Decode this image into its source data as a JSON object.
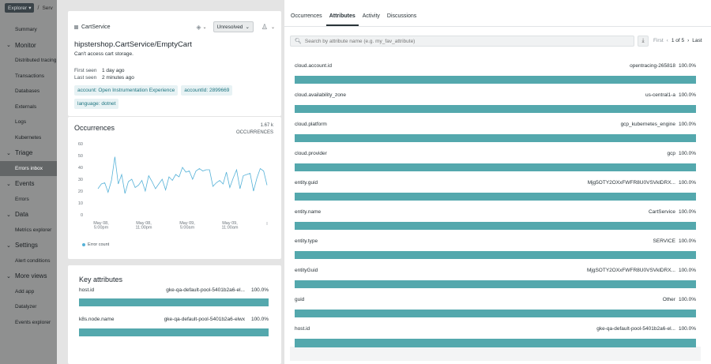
{
  "nav": {
    "explorer_label": "Explorer",
    "crumb_sep": "/",
    "crumb_text": "Serv",
    "summary": "Summary",
    "monitor": "Monitor",
    "monitor_items": [
      "Distributed tracing",
      "Transactions",
      "Databases",
      "Externals",
      "Logs",
      "Kubernetes"
    ],
    "triage": "Triage",
    "triage_items": [
      "Errors inbox"
    ],
    "events": "Events",
    "events_items": [
      "Errors"
    ],
    "data": "Data",
    "data_items": [
      "Metrics explorer"
    ],
    "settings": "Settings",
    "settings_items": [
      "Alert conditions"
    ],
    "more_views": "More views",
    "more_items": [
      "Add app",
      "Datalyzer",
      "Events explorer"
    ]
  },
  "error": {
    "service": "CartService",
    "status": "Unresolved",
    "title": "hipstershop.CartService/EmptyCart",
    "message": "Can't access cart storage.",
    "first_seen_label": "First seen",
    "first_seen": "1 day ago",
    "last_seen_label": "Last seen",
    "last_seen": "2 minutes ago",
    "tags": [
      "account: Open Instrumentation Experience",
      "accountId: 2899669",
      "language: dotnet"
    ]
  },
  "occurrences": {
    "title": "Occurrences",
    "count": "1.67 k",
    "count_label": "OCCURRENCES",
    "legend": "Error count"
  },
  "chart_data": {
    "type": "line",
    "x_ticks": [
      "May 08,\n5:00pm",
      "May 08,\n11:00pm",
      "May 09,\n5:00am",
      "May 09,\n11:00am"
    ],
    "ylim": [
      0,
      60
    ],
    "y_ticks": [
      0,
      10,
      20,
      30,
      40,
      50,
      60
    ],
    "series": [
      {
        "name": "Error count",
        "color": "#56b2d8",
        "values": [
          22,
          26,
          27,
          19,
          29,
          49,
          26,
          34,
          18,
          28,
          30,
          23,
          25,
          29,
          20,
          33,
          28,
          22,
          26,
          30,
          21,
          32,
          29,
          34,
          32,
          40,
          36,
          37,
          30,
          37,
          39,
          37,
          38,
          38,
          24,
          27,
          29,
          26,
          36,
          23,
          31,
          38,
          22,
          33,
          34,
          35,
          20,
          31,
          39,
          37,
          25
        ]
      }
    ]
  },
  "key_attributes": {
    "title": "Key attributes",
    "rows": [
      {
        "key": "host.id",
        "value": "gke-qa-default-pool-5401b2a6-el...",
        "pct": "100.0%"
      },
      {
        "key": "k8s.node.name",
        "value": "gke-qa-default-pool-5401b2a6-elwx",
        "pct": "100.0%"
      }
    ]
  },
  "tabs": [
    "Occurrences",
    "Attributes",
    "Activity",
    "Discussions"
  ],
  "active_tab": "Attributes",
  "search": {
    "placeholder": "Search by attribute name (e.g. my_fav_attribute)"
  },
  "pager": {
    "first": "First",
    "prev": "‹",
    "label": "1 of 5",
    "next": "›",
    "last": "Last"
  },
  "attributes": [
    {
      "key": "cloud.account.id",
      "value": "opentracing-265818",
      "pct": "100.0%"
    },
    {
      "key": "cloud.availability_zone",
      "value": "us-central1-a",
      "pct": "100.0%"
    },
    {
      "key": "cloud.platform",
      "value": "gcp_kubernetes_engine",
      "pct": "100.0%"
    },
    {
      "key": "cloud.provider",
      "value": "gcp",
      "pct": "100.0%"
    },
    {
      "key": "entity.guid",
      "value": "Mjg5OTY2OXxFWFR8U0VSVklDRX...",
      "pct": "100.0%"
    },
    {
      "key": "entity.name",
      "value": "CartService",
      "pct": "100.0%"
    },
    {
      "key": "entity.type",
      "value": "SERVICE",
      "pct": "100.0%"
    },
    {
      "key": "entityGuid",
      "value": "MjgSOTY2OXxFWFR8U0VSVklDRX...",
      "pct": "100.0%"
    },
    {
      "key": "guid",
      "value": "Other",
      "pct": "100.0%"
    },
    {
      "key": "host.id",
      "value": "gke-qa-default-pool-5401b2a6-el...",
      "pct": "100.0%"
    }
  ]
}
